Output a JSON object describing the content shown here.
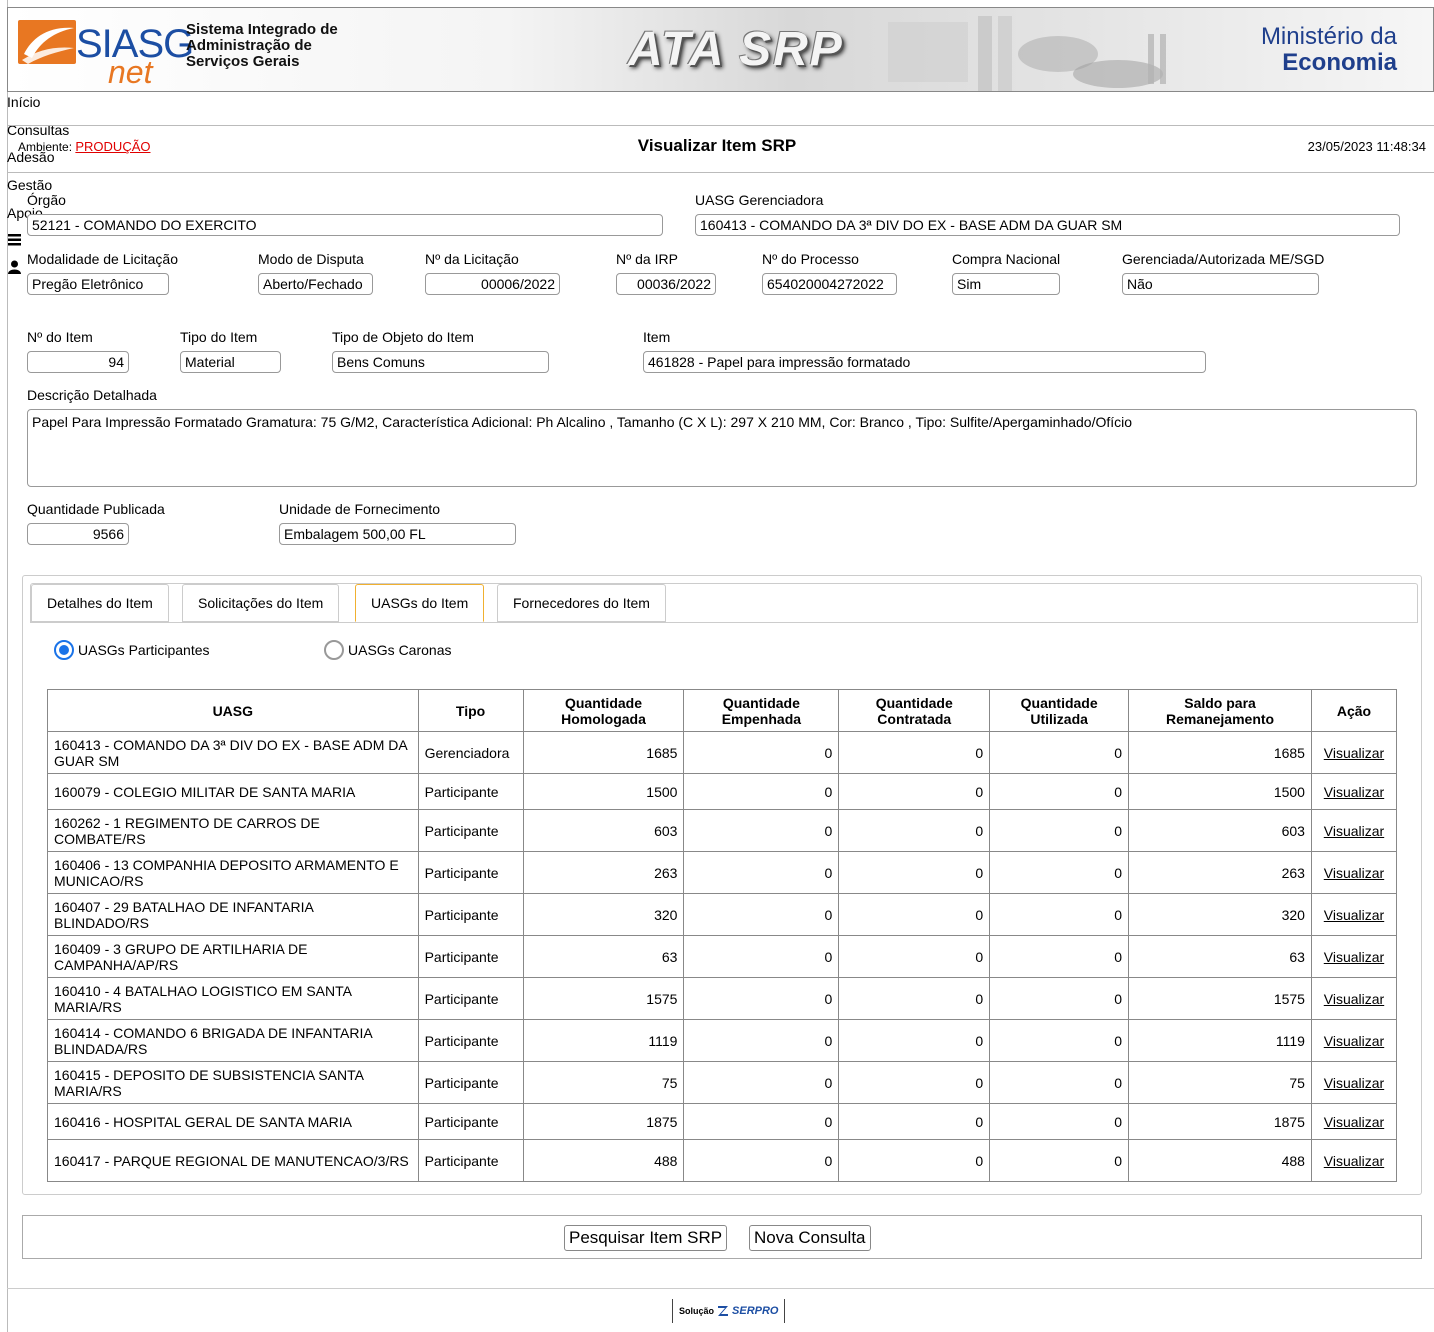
{
  "header": {
    "logo_siasg": "SIASG",
    "logo_net": "net",
    "sistema_lines": [
      "Sistema Integrado de",
      "Administração de",
      "Serviços Gerais"
    ],
    "banner_title": "ATA SRP",
    "ministerio_line1": "Ministério da",
    "ministerio_line2": "Economia"
  },
  "nav": {
    "items": [
      "Início",
      "Consultas",
      "Adesão",
      "Gestão",
      "Apoio"
    ]
  },
  "status": {
    "ambiente_label": "Ambiente:",
    "ambiente_value": "PRODUÇÃO",
    "page_title": "Visualizar Item SRP",
    "datetime": "23/05/2023 11:48:34"
  },
  "form": {
    "orgao_label": "Órgão",
    "orgao_value": "52121 - COMANDO DO EXERCITO",
    "uasg_ger_label": "UASG Gerenciadora",
    "uasg_ger_value": "160413 - COMANDO DA 3ª DIV DO EX - BASE ADM DA GUAR SM",
    "modalidade_label": "Modalidade de Licitação",
    "modalidade_value": "Pregão Eletrônico",
    "modo_label": "Modo de Disputa",
    "modo_value": "Aberto/Fechado",
    "licitacao_label": "Nº da Licitação",
    "licitacao_value": "00006/2022",
    "irp_label": "Nº da IRP",
    "irp_value": "00036/2022",
    "processo_label": "Nº do Processo",
    "processo_value": "654020004272022",
    "compra_label": "Compra Nacional",
    "compra_value": "Sim",
    "gerenciada_label": "Gerenciada/Autorizada ME/SGD",
    "gerenciada_value": "Não",
    "nitem_label": "Nº do Item",
    "nitem_value": "94",
    "tipo_item_label": "Tipo do Item",
    "tipo_item_value": "Material",
    "tipo_objeto_label": "Tipo de Objeto do Item",
    "tipo_objeto_value": "Bens Comuns",
    "item_label": "Item",
    "item_value": "461828 - Papel para impressão formatado",
    "descricao_label": "Descrição Detalhada",
    "descricao_value": "Papel Para Impressão Formatado Gramatura: 75 G/M2, Característica Adicional: Ph Alcalino , Tamanho (C X L): 297 X 210 MM, Cor: Branco , Tipo: Sulfite/Apergaminhado/Ofício",
    "quantidade_label": "Quantidade Publicada",
    "quantidade_value": "9566",
    "unidade_label": "Unidade de Fornecimento",
    "unidade_value": "Embalagem 500,00 FL"
  },
  "tabs": [
    {
      "label": "Detalhes do Item",
      "active": false
    },
    {
      "label": "Solicitações do Item",
      "active": false
    },
    {
      "label": "UASGs do Item",
      "active": true
    },
    {
      "label": "Fornecedores do Item",
      "active": false
    }
  ],
  "radios": {
    "participantes": "UASGs Participantes",
    "caronas": "UASGs Caronas",
    "selected": "participantes"
  },
  "table": {
    "headers": [
      "UASG",
      "Tipo",
      "Quantidade Homologada",
      "Quantidade Empenhada",
      "Quantidade Contratada",
      "Quantidade Utilizada",
      "Saldo para Remanejamento",
      "Ação"
    ],
    "rows": [
      {
        "uasg": "160413 - COMANDO DA 3ª DIV DO EX - BASE ADM DA GUAR SM",
        "tipo": "Gerenciadora",
        "homologada": "1685",
        "empenhada": "0",
        "contratada": "0",
        "utilizada": "0",
        "saldo": "1685",
        "acao": "Visualizar"
      },
      {
        "uasg": "160079 - COLEGIO MILITAR DE SANTA MARIA",
        "tipo": "Participante",
        "homologada": "1500",
        "empenhada": "0",
        "contratada": "0",
        "utilizada": "0",
        "saldo": "1500",
        "acao": "Visualizar"
      },
      {
        "uasg": "160262 - 1 REGIMENTO DE CARROS DE COMBATE/RS",
        "tipo": "Participante",
        "homologada": "603",
        "empenhada": "0",
        "contratada": "0",
        "utilizada": "0",
        "saldo": "603",
        "acao": "Visualizar"
      },
      {
        "uasg": "160406 - 13 COMPANHIA DEPOSITO ARMAMENTO E MUNICAO/RS",
        "tipo": "Participante",
        "homologada": "263",
        "empenhada": "0",
        "contratada": "0",
        "utilizada": "0",
        "saldo": "263",
        "acao": "Visualizar"
      },
      {
        "uasg": "160407 - 29 BATALHAO DE INFANTARIA BLINDADO/RS",
        "tipo": "Participante",
        "homologada": "320",
        "empenhada": "0",
        "contratada": "0",
        "utilizada": "0",
        "saldo": "320",
        "acao": "Visualizar"
      },
      {
        "uasg": "160409 - 3 GRUPO DE ARTILHARIA DE CAMPANHA/AP/RS",
        "tipo": "Participante",
        "homologada": "63",
        "empenhada": "0",
        "contratada": "0",
        "utilizada": "0",
        "saldo": "63",
        "acao": "Visualizar"
      },
      {
        "uasg": "160410 - 4 BATALHAO LOGISTICO EM SANTA MARIA/RS",
        "tipo": "Participante",
        "homologada": "1575",
        "empenhada": "0",
        "contratada": "0",
        "utilizada": "0",
        "saldo": "1575",
        "acao": "Visualizar"
      },
      {
        "uasg": "160414 - COMANDO 6 BRIGADA DE INFANTARIA BLINDADA/RS",
        "tipo": "Participante",
        "homologada": "1119",
        "empenhada": "0",
        "contratada": "0",
        "utilizada": "0",
        "saldo": "1119",
        "acao": "Visualizar"
      },
      {
        "uasg": "160415 - DEPOSITO DE SUBSISTENCIA SANTA MARIA/RS",
        "tipo": "Participante",
        "homologada": "75",
        "empenhada": "0",
        "contratada": "0",
        "utilizada": "0",
        "saldo": "75",
        "acao": "Visualizar"
      },
      {
        "uasg": "160416 - HOSPITAL GERAL DE SANTA MARIA",
        "tipo": "Participante",
        "homologada": "1875",
        "empenhada": "0",
        "contratada": "0",
        "utilizada": "0",
        "saldo": "1875",
        "acao": "Visualizar"
      },
      {
        "uasg": "160417 - PARQUE REGIONAL DE MANUTENCAO/3/RS",
        "tipo": "Participante",
        "homologada": "488",
        "empenhada": "0",
        "contratada": "0",
        "utilizada": "0",
        "saldo": "488",
        "acao": "Visualizar"
      }
    ]
  },
  "buttons": {
    "pesquisar": "Pesquisar Item SRP",
    "nova": "Nova Consulta"
  },
  "footer": {
    "solucao": "Solução",
    "serpro": "SERPRO"
  },
  "colors": {
    "brand_blue": "#1c4ea3",
    "brand_orange": "#e87722",
    "ambiente_red": "#e00000",
    "active_tab_border": "#f0b030",
    "radio_selected": "#1a73e8"
  },
  "icons": [
    "menu-icon",
    "user-icon",
    "radio-selected-icon",
    "radio-unselected-icon"
  ]
}
